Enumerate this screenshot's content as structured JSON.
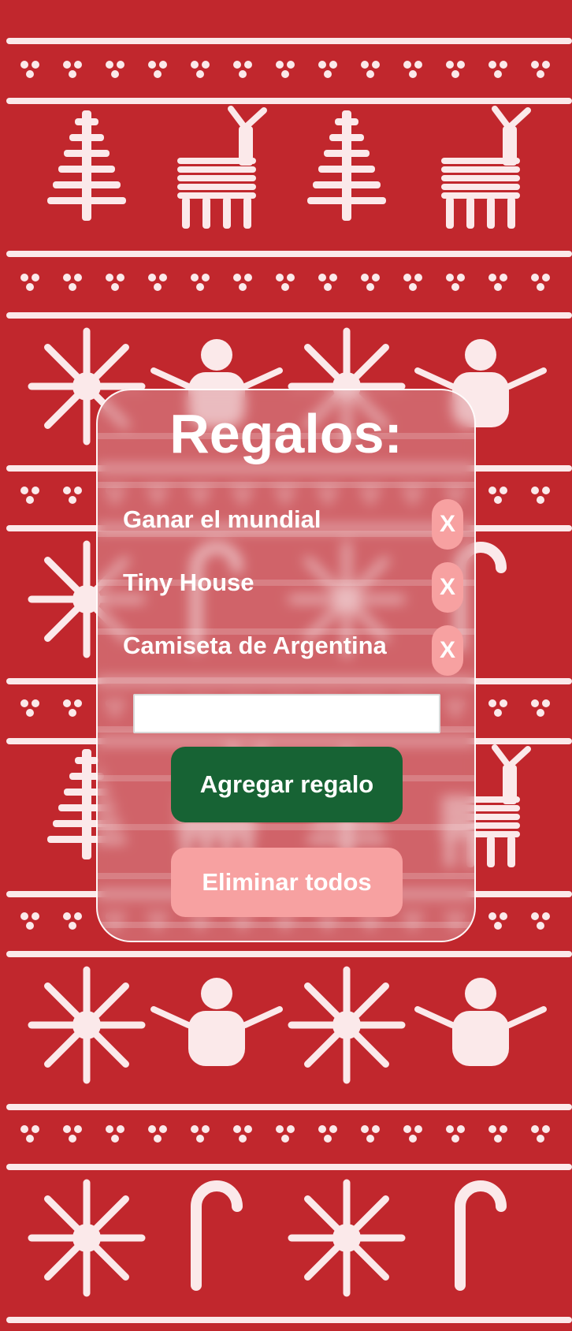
{
  "page": {
    "title": "Regalos:"
  },
  "gifts": [
    {
      "label": "Ganar el mundial",
      "delete_label": "X"
    },
    {
      "label": "Tiny House",
      "delete_label": "X"
    },
    {
      "label": "Camiseta de Argentina",
      "delete_label": "X"
    }
  ],
  "form": {
    "input_value": "",
    "add_label": "Agregar regalo",
    "clear_label": "Eliminar todos"
  },
  "colors": {
    "background_red": "#c1272d",
    "pattern_white": "#fbe9ea",
    "add_button": "#176334",
    "pink_button": "#f7a1a1"
  }
}
